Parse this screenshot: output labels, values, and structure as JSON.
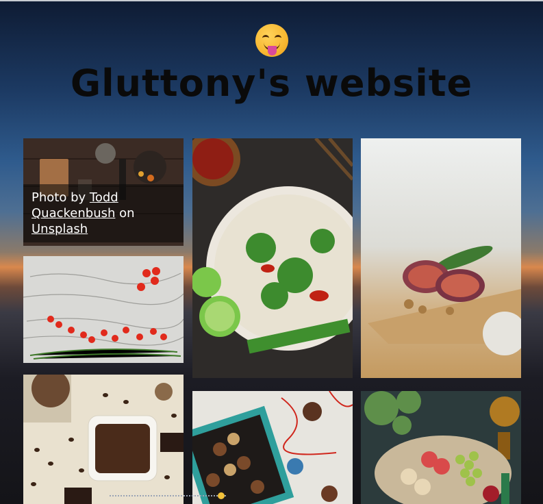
{
  "site": {
    "title": "Gluttony's website",
    "emoji": "drooling-face-icon"
  },
  "gallery": {
    "caption": {
      "prefix": "Photo by",
      "author": "Todd Quackenbush",
      "middle": "on",
      "source": "Unsplash"
    },
    "photos": [
      {
        "subject": "kitchen tools and spices on dark wood"
      },
      {
        "subject": "cherry tomatoes and chives on white wood"
      },
      {
        "subject": "noodle soup bowl with lime and chillies"
      },
      {
        "subject": "sliced figs on wooden board"
      },
      {
        "subject": "coffee beans and chocolate"
      },
      {
        "subject": "box of chocolates with ribbon"
      },
      {
        "subject": "fruit and cheese platter"
      }
    ]
  },
  "colors": {
    "caption_bg": "#0a0a0a",
    "title": "#0a0a0a",
    "scroll_thumb": "#f3c23a"
  }
}
